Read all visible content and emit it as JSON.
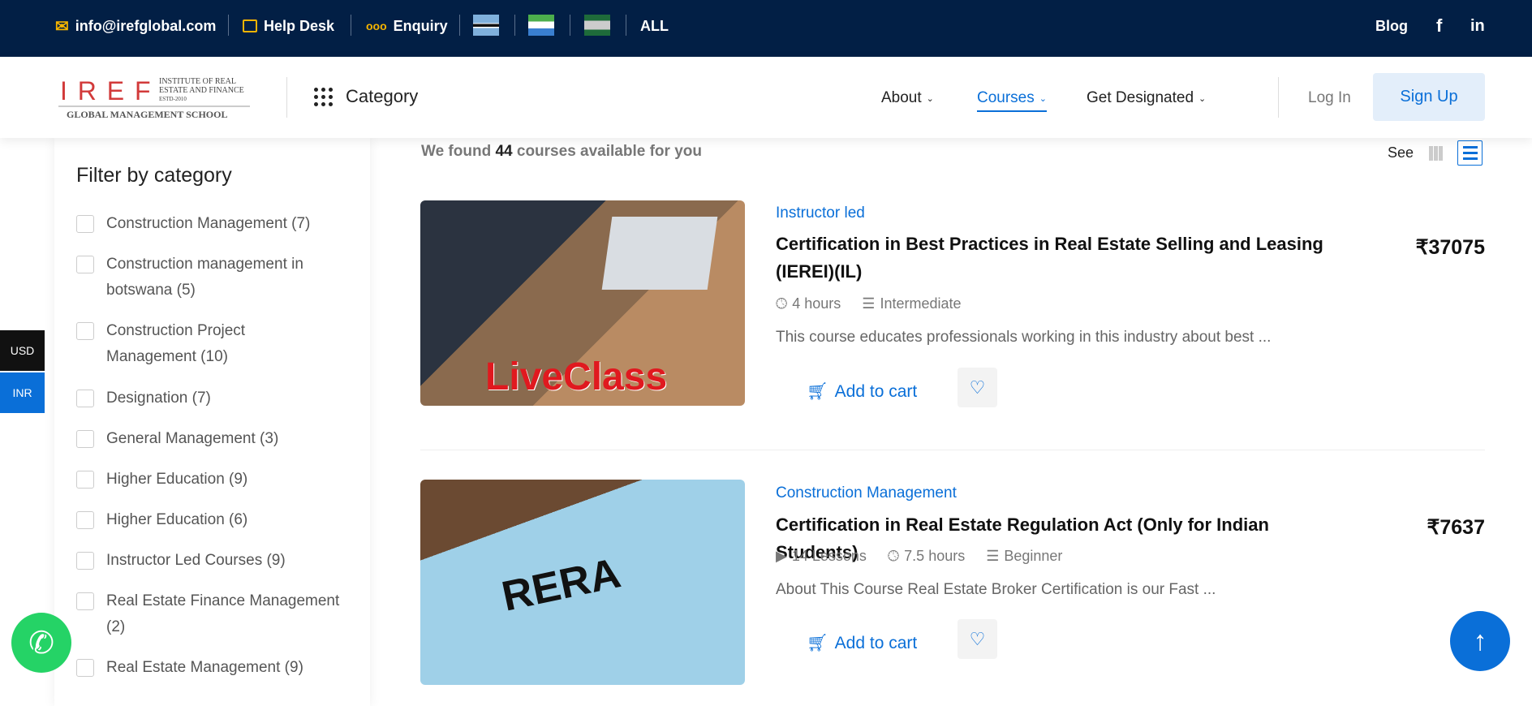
{
  "topbar": {
    "email": "info@irefglobal.com",
    "help": "Help Desk",
    "enquiry": "Enquiry",
    "all": "ALL",
    "blog": "Blog",
    "facebook": "f",
    "linkedin": "in"
  },
  "logo": {
    "letters": "I R E F",
    "line1": "INSTITUTE OF REAL",
    "line2": "ESTATE AND FINANCE",
    "estd": "ESTD-2010",
    "school": "GLOBAL MANAGEMENT SCHOOL"
  },
  "header": {
    "category": "Category",
    "nav": [
      "About",
      "Courses",
      "Get Designated"
    ],
    "login": "Log In",
    "signup": "Sign Up"
  },
  "sidebar": {
    "title": "Filter by category",
    "items": [
      "Construction Management (7)",
      "Construction management in botswana (5)",
      "Construction Project Management (10)",
      "Designation (7)",
      "General Management (3)",
      "Higher Education (9)",
      "Higher Education (6)",
      "Instructor Led Courses (9)",
      "Real Estate Finance Management (2)",
      "Real Estate Management (9)"
    ]
  },
  "results": {
    "pre": "We found ",
    "count": "44",
    "post": " courses available for you",
    "see": "See"
  },
  "currency": {
    "usd": "USD",
    "inr": "INR"
  },
  "courses": [
    {
      "category": "Instructor led",
      "title": "Certification in Best Practices in Real Estate Selling and Leasing (IEREI)(IL)",
      "price": "₹37075",
      "hours": "4 hours",
      "level": "Intermediate",
      "desc": "This course educates professionals working in this industry about best ...",
      "cart": "Add to cart",
      "image_text": "LiveClass"
    },
    {
      "category": "Construction Management",
      "title": "Certification in Real Estate Regulation Act (Only for Indian Students)",
      "price": "₹7637",
      "lessons": "14 Lessons",
      "hours": "7.5 hours",
      "level": "Beginner",
      "desc": "About This Course Real Estate Broker Certification is our Fast ...",
      "cart": "Add to cart",
      "image_text": "RERA"
    }
  ]
}
